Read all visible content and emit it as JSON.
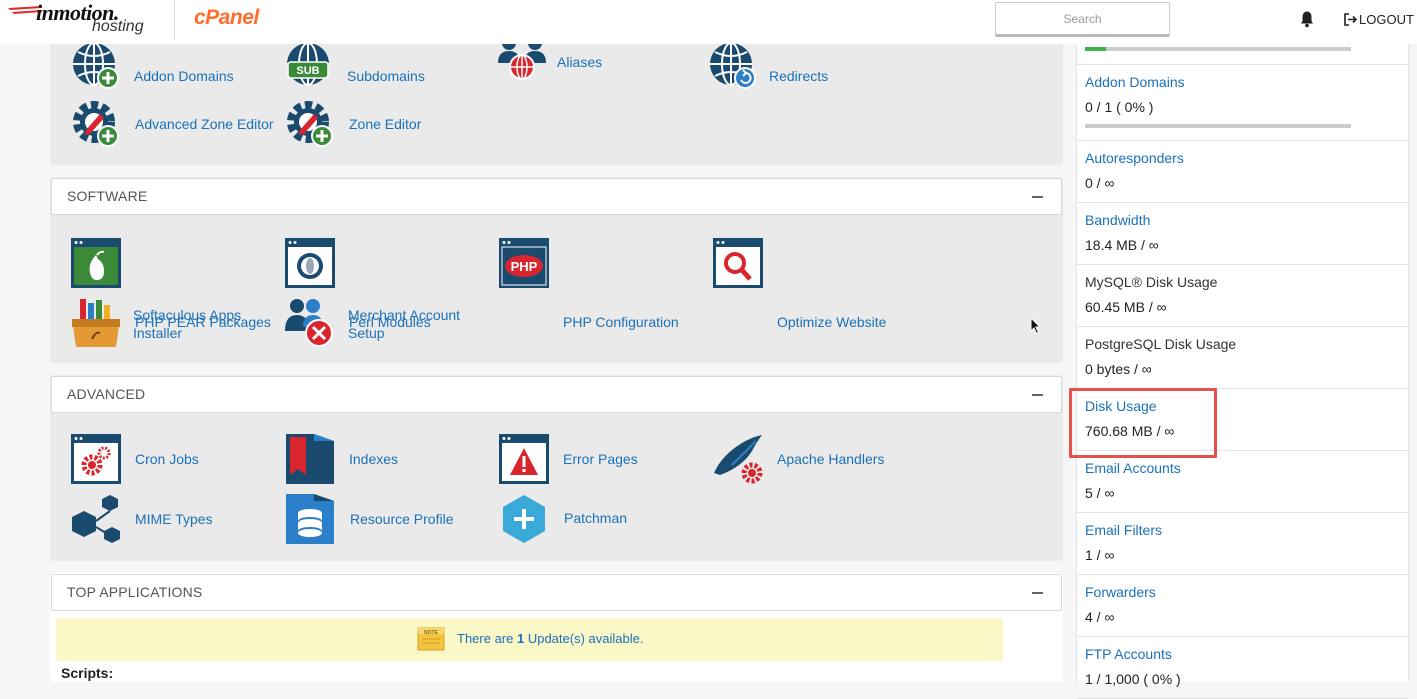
{
  "header": {
    "logo_brand": "inmotion.",
    "logo_sub": "hosting",
    "cpanel_logo": "cPanel",
    "search_placeholder": "Search",
    "logout_label": "LOGOUT",
    "icons": {
      "notifications": "bell-icon",
      "logout": "logout-arrow-icon"
    }
  },
  "colors": {
    "link": "#1b71b9",
    "panel_bg": "#eaeaea",
    "icon_dark": "#1a4a6e",
    "icon_green": "#3a8a3a",
    "icon_red": "#d9262e",
    "cpanel_orange": "#ff6c2c",
    "highlight": "#e7514b"
  },
  "domains_section": {
    "tools": [
      {
        "label": "Addon Domains",
        "icon": "globe-plus-icon"
      },
      {
        "label": "Subdomains",
        "icon": "globe-sub-icon"
      },
      {
        "label": "Aliases",
        "icon": "aliases-icon"
      },
      {
        "label": "Redirects",
        "icon": "globe-redirect-icon"
      },
      {
        "label": "Advanced Zone Editor",
        "icon": "gear-pencil-icon"
      },
      {
        "label": "Zone Editor",
        "icon": "gear-pencil-icon"
      }
    ]
  },
  "software_section": {
    "title": "SOFTWARE",
    "tools": [
      {
        "label": "PHP PEAR Packages",
        "icon": "php-pear-icon"
      },
      {
        "label": "Perl Modules",
        "icon": "perl-icon"
      },
      {
        "label": "PHP Configuration",
        "icon": "php-config-icon"
      },
      {
        "label": "Optimize Website",
        "icon": "optimize-icon"
      },
      {
        "label_line1": "Softaculous Apps",
        "label_line2": "Installer",
        "icon": "softaculous-icon"
      },
      {
        "label_line1": "Merchant Account",
        "label_line2": "Setup",
        "icon": "merchant-icon"
      }
    ]
  },
  "advanced_section": {
    "title": "ADVANCED",
    "tools": [
      {
        "label": "Cron Jobs",
        "icon": "cron-icon"
      },
      {
        "label": "Indexes",
        "icon": "indexes-icon"
      },
      {
        "label": "Error Pages",
        "icon": "error-pages-icon"
      },
      {
        "label": "Apache Handlers",
        "icon": "apache-icon"
      },
      {
        "label": "MIME Types",
        "icon": "mime-icon"
      },
      {
        "label": "Resource Profile",
        "icon": "resource-profile-icon"
      },
      {
        "label": "Patchman",
        "icon": "patchman-icon"
      }
    ]
  },
  "top_apps_section": {
    "title": "TOP APPLICATIONS",
    "update_prefix": "There are ",
    "update_count": "1",
    "update_suffix": " Update(s) available.",
    "note_label": "NOTE",
    "scripts_label": "Scripts:"
  },
  "stats": [
    {
      "name": "Addon Domains",
      "value": "0 / 1 ( 0% )",
      "link": true,
      "progress": 0
    },
    {
      "name": "Autoresponders",
      "value": "0 / ∞",
      "link": true
    },
    {
      "name": "Bandwidth",
      "value": "18.4 MB / ∞",
      "link": true
    },
    {
      "name": "MySQL® Disk Usage",
      "value": "60.45 MB / ∞",
      "link": false
    },
    {
      "name": "PostgreSQL Disk Usage",
      "value": "0 bytes / ∞",
      "link": false
    },
    {
      "name": "Disk Usage",
      "value": "760.68 MB / ∞",
      "link": true
    },
    {
      "name": "Email Accounts",
      "value": "5 / ∞",
      "link": true
    },
    {
      "name": "Email Filters",
      "value": "1 / ∞",
      "link": true
    },
    {
      "name": "Forwarders",
      "value": "4 / ∞",
      "link": true
    },
    {
      "name": "FTP Accounts",
      "value": "1 / 1,000 ( 0% )",
      "link": true
    }
  ],
  "top_stat_progress": 0.08
}
